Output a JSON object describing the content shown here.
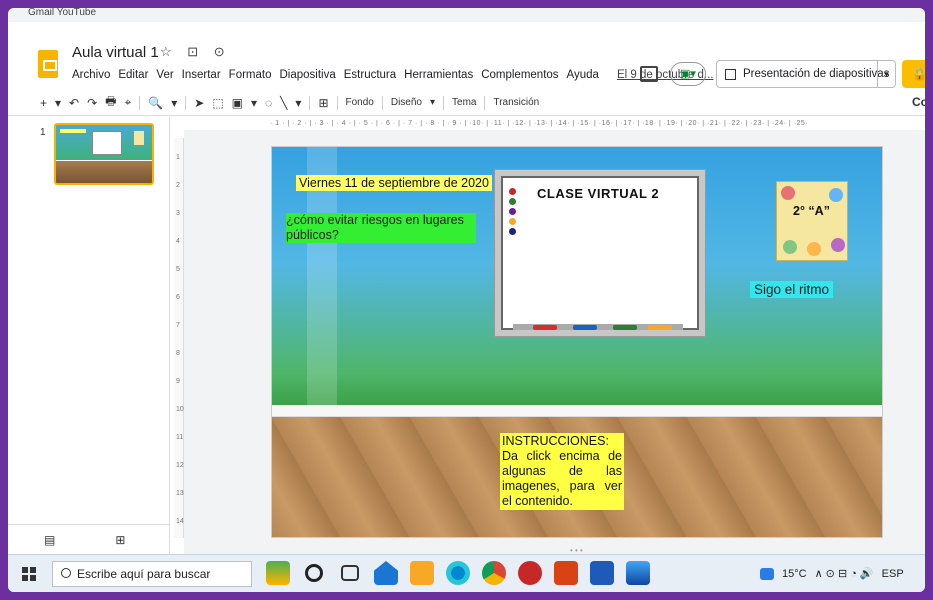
{
  "browser": {
    "tabs_text": "Gmail    YouTube"
  },
  "header": {
    "doc_title": "Aula virtual 1",
    "title_icons": "☆ ⊡ ⊙",
    "menu": [
      "Archivo",
      "Editar",
      "Ver",
      "Insertar",
      "Formato",
      "Diapositiva",
      "Estructura",
      "Herramientas",
      "Complementos",
      "Ayuda"
    ],
    "last_edit": "El 9 de octubre d...",
    "present_label": "Presentación de diapositivas",
    "share_label": "Co"
  },
  "toolbar": {
    "items": [
      "+",
      "▾",
      "↶",
      "↷",
      "🖶",
      "⌖",
      "🔍",
      "▾",
      "➤",
      "⬚",
      "▣",
      "▾",
      "◌",
      "╲",
      "▾",
      "⊞"
    ],
    "background_label": "Fondo",
    "layout_label": "Diseño",
    "theme_label": "Tema",
    "transition_label": "Transición"
  },
  "filmstrip": {
    "slide_number": "1",
    "bottom_icons": [
      "▤",
      "⊞",
      "‹"
    ]
  },
  "ruler": {
    "top": "· 1 · | · 2 · | · 3 · | · 4 · | · 5 · | · 6 · | · 7 · | · 8 · | · 9 · | ·10· | ·11· | ·12· | ·13· | ·14· | ·15· | ·16· | ·17· | ·18· | ·19· | ·20· | ·21· | ·22· | ·23· | ·24· | ·25·",
    "left": [
      "1",
      "2",
      "3",
      "4",
      "5",
      "6",
      "7",
      "8",
      "9",
      "10",
      "11",
      "12",
      "13",
      "14"
    ]
  },
  "slide": {
    "date_text": "Viernes 11 de septiembre de 2020",
    "question_text": "¿cómo evitar riesgos en lugares públicos?",
    "board_title": "CLASE  VIRTUAL  2",
    "grade_text": "2° “A”",
    "rhythm_text": "Sigo el ritmo",
    "instructions_title": "INSTRUCCIONES:",
    "instructions_body": "Da click encima de algunas de las imagenes, para ver el contenido."
  },
  "taskbar": {
    "search_placeholder": "Escribe aquí para buscar",
    "temperature": "15°C",
    "tray_icons": "∧ ⊙ ⊟ ◔ 🔊",
    "language": "ESP"
  },
  "colors": {
    "frame": "#6b2fa0",
    "highlight_yellow": "#ffff66",
    "highlight_green": "#33ee33",
    "highlight_cyan": "#33e6ee",
    "slides_icon": "#f4b400"
  }
}
